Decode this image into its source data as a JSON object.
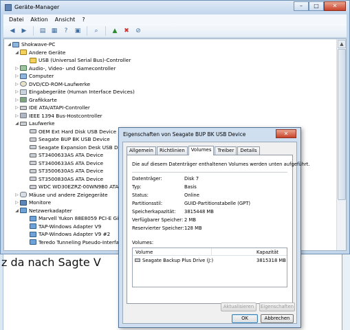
{
  "background": {
    "fragment_t": "t",
    "fragment_r": "r",
    "fragment_text": "z da nach Sagte V"
  },
  "window": {
    "title": "Geräte-Manager",
    "controls": {
      "minimize": "–",
      "maximize": "□",
      "close": "✕"
    }
  },
  "menubar": {
    "items": [
      "Datei",
      "Aktion",
      "Ansicht",
      "?"
    ]
  },
  "toolbar": {
    "icons": [
      "back-arrow-icon",
      "forward-arrow-icon",
      "device-view-icon",
      "properties-icon",
      "help-icon",
      "show-hidden-icon",
      "scan-hardware-icon",
      "update-driver-icon",
      "uninstall-icon",
      "disable-icon"
    ]
  },
  "tree": {
    "root": "Shokwave-PC",
    "items": [
      {
        "label": "Andere Geräte",
        "level": 1,
        "expander": "expanded",
        "icon": "warn"
      },
      {
        "label": "USB (Universal Serial Bus)-Controller",
        "level": 2,
        "expander": "none",
        "icon": "warn"
      },
      {
        "label": "Audio-, Video- und Gamecontroller",
        "level": 1,
        "expander": "collapsed",
        "icon": "sound"
      },
      {
        "label": "Computer",
        "level": 1,
        "expander": "collapsed",
        "icon": "pc"
      },
      {
        "label": "DVD/CD-ROM-Laufwerke",
        "level": 1,
        "expander": "collapsed",
        "icon": "cd"
      },
      {
        "label": "Eingabegeräte (Human Interface Devices)",
        "level": 1,
        "expander": "collapsed",
        "icon": "kbd"
      },
      {
        "label": "Grafikkarte",
        "level": 1,
        "expander": "collapsed",
        "icon": "gfx"
      },
      {
        "label": "IDE ATA/ATAPI-Controller",
        "level": 1,
        "expander": "collapsed",
        "icon": "disk"
      },
      {
        "label": "IEEE 1394 Bus-Hostcontroller",
        "level": 1,
        "expander": "collapsed",
        "icon": "firewire"
      },
      {
        "label": "Laufwerke",
        "level": 1,
        "expander": "expanded",
        "icon": "disk"
      },
      {
        "label": "OEM Ext Hard Disk USB Device",
        "level": 2,
        "expander": "none",
        "icon": "disk"
      },
      {
        "label": "Seagate BUP BK USB Device",
        "level": 2,
        "expander": "none",
        "icon": "disk"
      },
      {
        "label": "Seagate Expansion Desk USB Device",
        "level": 2,
        "expander": "none",
        "icon": "disk"
      },
      {
        "label": "ST3400633AS ATA Device",
        "level": 2,
        "expander": "none",
        "icon": "disk"
      },
      {
        "label": "ST3400633AS ATA Device",
        "level": 2,
        "expander": "none",
        "icon": "disk"
      },
      {
        "label": "ST3500630AS ATA Device",
        "level": 2,
        "expander": "none",
        "icon": "disk"
      },
      {
        "label": "ST3500830AS ATA Device",
        "level": 2,
        "expander": "none",
        "icon": "disk"
      },
      {
        "label": "WDC WD30EZRZ-00WN9B0 ATA Device",
        "level": 2,
        "expander": "none",
        "icon": "disk"
      },
      {
        "label": "Mäuse und andere Zeigegeräte",
        "level": 1,
        "expander": "collapsed",
        "icon": "mouse"
      },
      {
        "label": "Monitore",
        "level": 1,
        "expander": "collapsed",
        "icon": "mon"
      },
      {
        "label": "Netzwerkadapter",
        "level": 1,
        "expander": "expanded",
        "icon": "net"
      },
      {
        "label": "Marvell Yukon 88E8059 PCI-E Gigabit Ethernet Controller",
        "level": 2,
        "expander": "none",
        "icon": "net"
      },
      {
        "label": "TAP-Windows Adapter V9",
        "level": 2,
        "expander": "none",
        "icon": "net"
      },
      {
        "label": "TAP-Windows Adapter V9 #2",
        "level": 2,
        "expander": "none",
        "icon": "net"
      },
      {
        "label": "Teredo Tunneling Pseudo-Interface",
        "level": 2,
        "expander": "none",
        "icon": "net"
      }
    ]
  },
  "dialog": {
    "title": "Eigenschaften von Seagate BUP BK USB Device",
    "close": "✕",
    "tabs": [
      "Allgemein",
      "Richtlinien",
      "Volumes",
      "Treiber",
      "Details"
    ],
    "active_tab": "Volumes",
    "intro": "Die auf diesem Datenträger enthaltenen Volumes werden unten aufgeführt.",
    "properties": [
      {
        "label": "Datenträger:",
        "value": "Disk 7"
      },
      {
        "label": "Typ:",
        "value": "Basis"
      },
      {
        "label": "Status:",
        "value": "Online"
      },
      {
        "label": "Partitionsstil:",
        "value": "GUID-Partitionstabelle (GPT)"
      },
      {
        "label": "Speicherkapazität:",
        "value": "3815448 MB"
      },
      {
        "label": "Verfügbarer Speicher:",
        "value": "2 MB"
      },
      {
        "label": "Reservierter Speicher:",
        "value": "128 MB"
      }
    ],
    "volumes_label": "Volumes:",
    "volumes_columns": [
      "Volume",
      "Kapazität"
    ],
    "volumes": [
      {
        "name": "Seagate Backup Plus Drive (J:)",
        "capacity": "3815318 MB"
      }
    ],
    "buttons": {
      "refresh": "Aktualisieren",
      "properties": "Eigenschaften",
      "ok": "OK",
      "cancel": "Abbrechen"
    }
  }
}
